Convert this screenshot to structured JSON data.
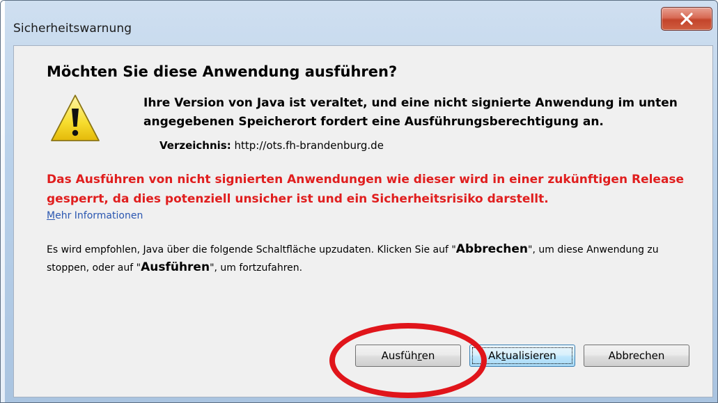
{
  "window": {
    "title": "Sicherheitswarnung",
    "close_label": "X"
  },
  "dialog": {
    "heading": "Möchten Sie diese Anwendung ausführen?",
    "icon": "warning-icon",
    "description": "Ihre Version von Java ist veraltet, und eine nicht signierte Anwendung im unten angegebenen Speicherort fordert eine Ausführungsberechtigung an.",
    "directory_label": "Verzeichnis:",
    "directory_value": "http://ots.fh-brandenburg.de",
    "red_warning": "Das Ausführen von nicht signierten Anwendungen wie dieser wird in einer zukünftigen Release gesperrt, da dies potenziell unsicher ist und ein Sicherheitsrisiko darstellt.",
    "more_info_link_mnemonic": "M",
    "more_info_link_rest": "ehr Informationen",
    "recommend_part1": "Es wird empfohlen, Java über die folgende Schaltfläche upzudaten. Klicken Sie auf \"",
    "recommend_cancel_word": "Abbrechen",
    "recommend_part2": "\", um diese Anwendung zu stoppen, oder auf \"",
    "recommend_run_word": "Ausführen",
    "recommend_part3": "\", um fortzufahren."
  },
  "buttons": {
    "run_pre": "Ausfüh",
    "run_mn": "r",
    "run_post": "en",
    "update_pre": "Ak",
    "update_mn": "t",
    "update_post": "ualisieren",
    "cancel": "Abbrechen"
  },
  "colors": {
    "warning_text": "#e01e1e",
    "link": "#2a56b0",
    "annotation_ring": "#e0151b",
    "close_button": "#c3442b"
  }
}
